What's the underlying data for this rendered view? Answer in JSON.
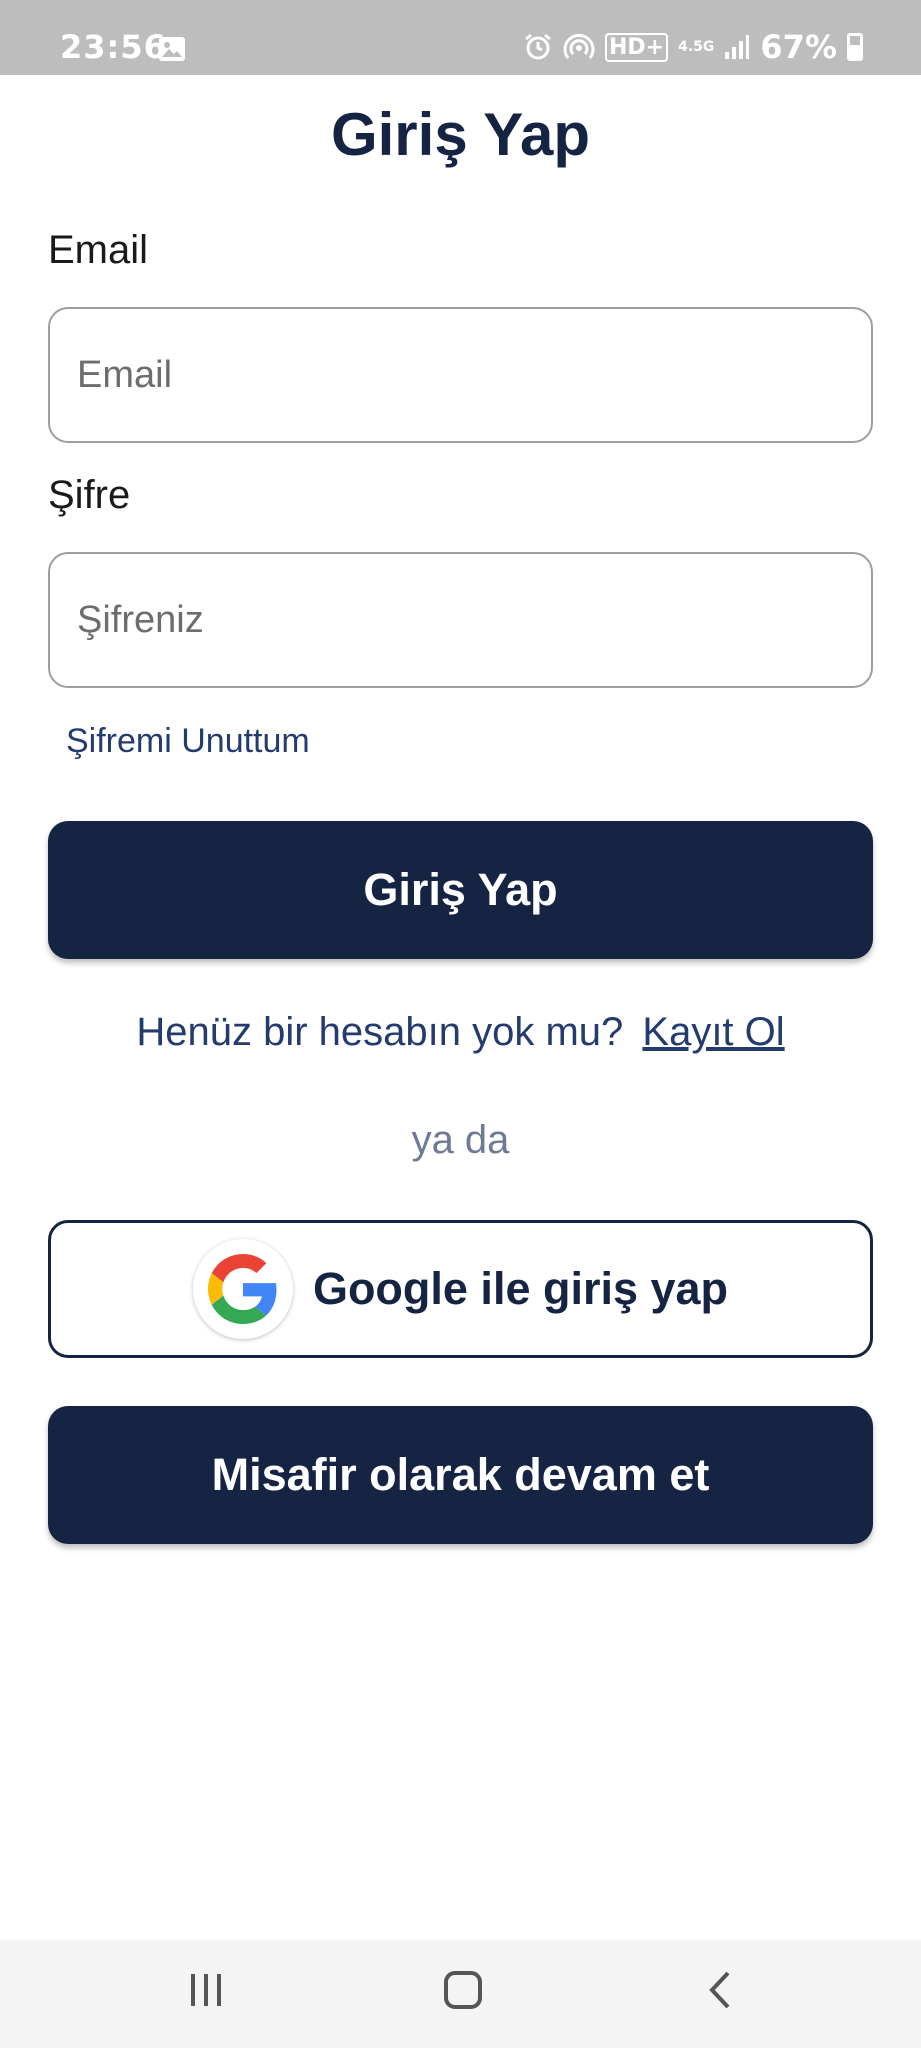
{
  "status_bar": {
    "time": "23:56",
    "battery_percent": "67%",
    "icons": [
      "gallery-icon",
      "alarm-icon",
      "hotspot-icon",
      "hd-plus-icon",
      "4.5g-icon",
      "signal-icon",
      "battery-icon"
    ],
    "network_label": "4.5G",
    "hd_label": "HD+"
  },
  "page": {
    "title": "Giriş Yap"
  },
  "form": {
    "email_label": "Email",
    "email_placeholder": "Email",
    "password_label": "Şifre",
    "password_placeholder": "Şifreniz",
    "forgot_password": "Şifremi Unuttum",
    "login_button": "Giriş Yap"
  },
  "signup": {
    "prompt": "Henüz bir hesabın yok mu?",
    "link": "Kayıt Ol"
  },
  "divider_text": "ya da",
  "google_button": {
    "label": "Google ile giriş yap",
    "icon": "google-icon"
  },
  "guest_button": {
    "label": "Misafir olarak devam et"
  },
  "nav_bar": {
    "buttons": [
      "recent-apps-icon",
      "home-icon",
      "back-icon"
    ]
  },
  "colors": {
    "primary": "#162444",
    "link": "#233b6e",
    "muted": "#6e7a96"
  }
}
